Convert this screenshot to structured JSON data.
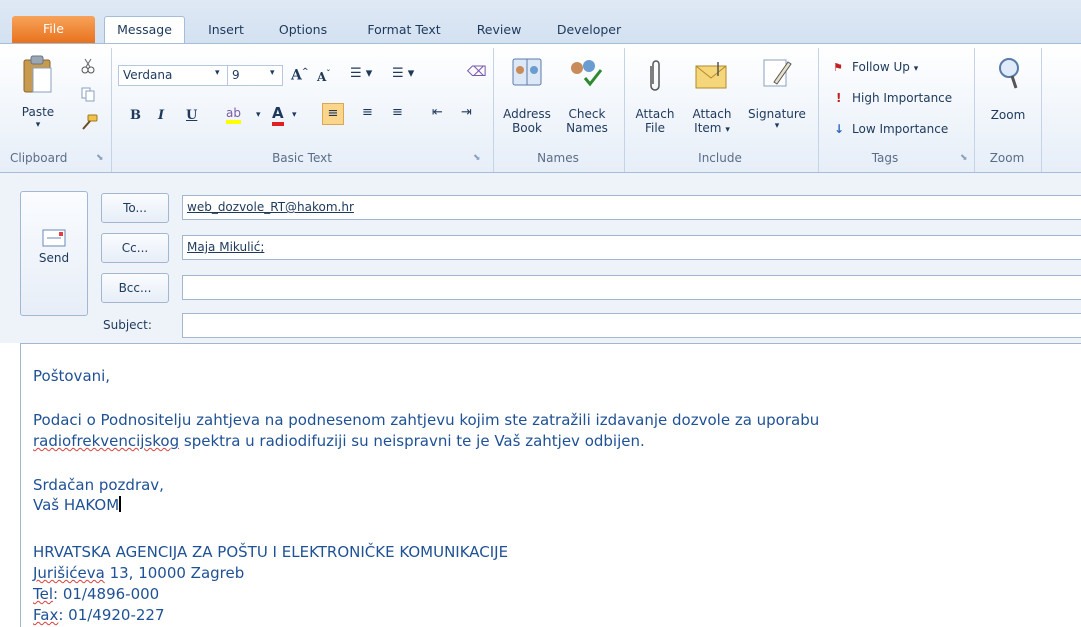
{
  "tabs": [
    "File",
    "Message",
    "Insert",
    "Options",
    "Format Text",
    "Review",
    "Developer"
  ],
  "clipboard": {
    "paste_label": "Paste",
    "group_label": "Clipboard"
  },
  "basic_text": {
    "font_name": "Verdana",
    "font_size": "9",
    "group_label": "Basic Text"
  },
  "names": {
    "address_book": [
      "Address",
      "Book"
    ],
    "check_names": [
      "Check",
      "Names"
    ],
    "group_label": "Names"
  },
  "include": {
    "attach_file": [
      "Attach",
      "File"
    ],
    "attach_item": [
      "Attach",
      "Item"
    ],
    "signature": "Signature",
    "group_label": "Include"
  },
  "tags": {
    "follow_up": "Follow Up",
    "high_importance": "High Importance",
    "low_importance": "Low Importance",
    "group_label": "Tags"
  },
  "zoom": {
    "label": "Zoom",
    "group_label": "Zoom"
  },
  "compose": {
    "send_label": "Send",
    "to_label": "To...",
    "cc_label": "Cc...",
    "bcc_label": "Bcc...",
    "subject_label": "Subject:",
    "to_value": "web_dozvole_RT@hakom.hr",
    "cc_value": "Maja Mikulić;",
    "bcc_value": "",
    "subject_value": ""
  },
  "message": {
    "greeting": "Poštovani,",
    "line1": "Podaci o Podnositelju zahtjeva na podnesenom zahtjevu kojim ste zatražili izdavanje dozvole za uporabu",
    "line2_a": "radiofrekvencijskog",
    "line2_b": " spektra u radiodifuziji su neispravni te je Vaš zahtjev odbijen.",
    "closing": "Srdačan pozdrav,",
    "sender": "Vaš HAKOM",
    "org": "HRVATSKA AGENCIJA ZA POŠTU I ELEKTRONIČKE KOMUNIKACIJE",
    "addr_a": "Jurišićeva",
    "addr_b": " 13, 10000 Zagreb",
    "tel_a": "Tel",
    "tel_b": ": 01/4896-000",
    "fax_a": "Fax",
    "fax_b": ": 01/4920-227"
  }
}
